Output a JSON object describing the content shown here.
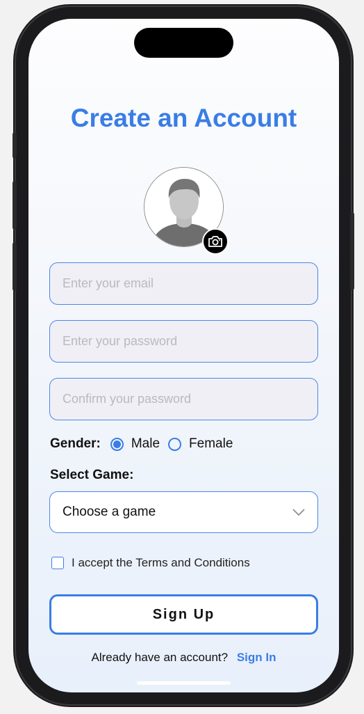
{
  "title": "Create an Account",
  "avatar": {
    "alt": "profile placeholder",
    "camera_icon": "camera-icon"
  },
  "form": {
    "email_placeholder": "Enter your email",
    "password_placeholder": "Enter your password",
    "confirm_placeholder": "Confirm your password",
    "gender_label": "Gender:",
    "gender_options": [
      "Male",
      "Female"
    ],
    "gender_selected": "Male",
    "game_label": "Select Game:",
    "game_selected": "Choose a game",
    "terms_label": "I accept the Terms and Conditions",
    "terms_checked": false,
    "signup_label": "Sign Up"
  },
  "footer": {
    "prompt": "Already have an account?",
    "link": "Sign In"
  },
  "colors": {
    "accent": "#3a7de6",
    "field_bg": "#f0eff5"
  }
}
